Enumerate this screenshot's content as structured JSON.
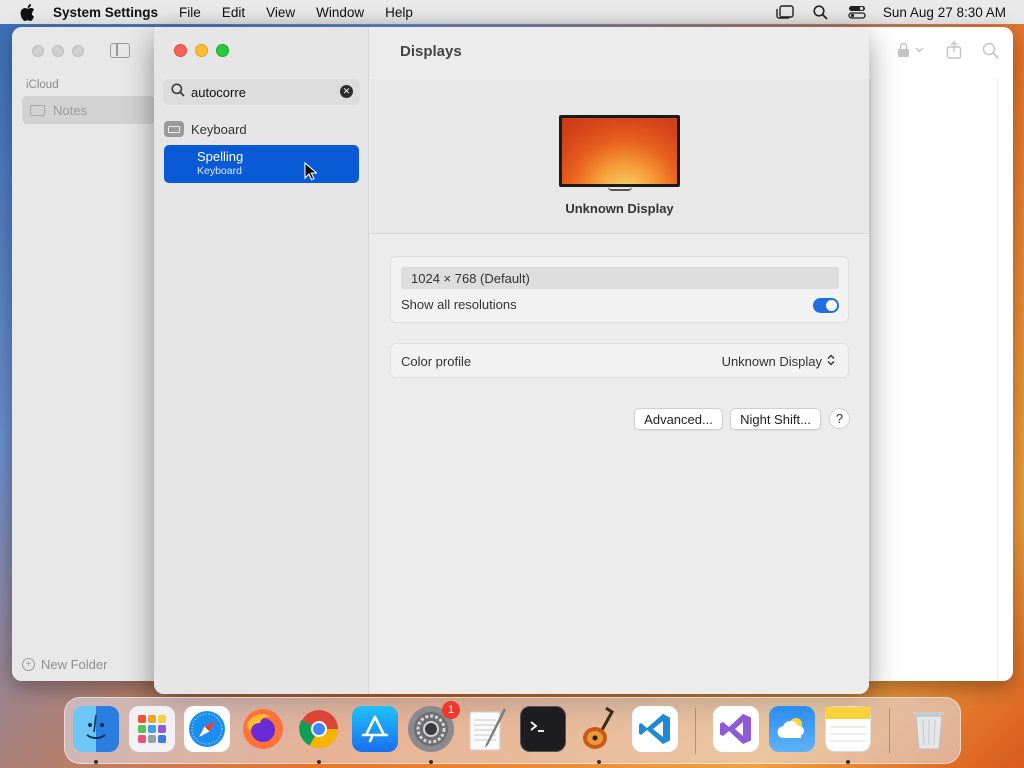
{
  "menubar": {
    "app_name": "System Settings",
    "items": [
      "File",
      "Edit",
      "View",
      "Window",
      "Help"
    ],
    "clock": "Sun Aug 27  8:30 AM"
  },
  "notes_window": {
    "account_label": "iCloud",
    "folder_label": "Notes",
    "new_folder_label": "New Folder"
  },
  "settings_window": {
    "search": {
      "value": "autocorre"
    },
    "results": [
      {
        "label": "Keyboard"
      },
      {
        "label": "Spelling",
        "sublabel": "Keyboard"
      }
    ],
    "title": "Displays",
    "display_name": "Unknown Display",
    "resolution": "1024 × 768 (Default)",
    "show_all_resolutions_label": "Show all resolutions",
    "show_all_resolutions_on": true,
    "color_profile_label": "Color profile",
    "color_profile_value": "Unknown Display",
    "advanced_label": "Advanced...",
    "night_shift_label": "Night Shift...",
    "help_label": "?"
  },
  "dock": {
    "apps": [
      "Finder",
      "Launchpad",
      "Safari",
      "Firefox",
      "Chrome",
      "App Store",
      "System Settings",
      "TextEdit",
      "Terminal",
      "GarageBand",
      "VS Code",
      "Visual Studio",
      "Weather",
      "Notes",
      "Trash"
    ],
    "system_settings_badge": "1"
  },
  "colors": {
    "accent": "#0a5ad6",
    "close": "#fe5f57",
    "minimize": "#febc2e",
    "zoom": "#28c840"
  }
}
